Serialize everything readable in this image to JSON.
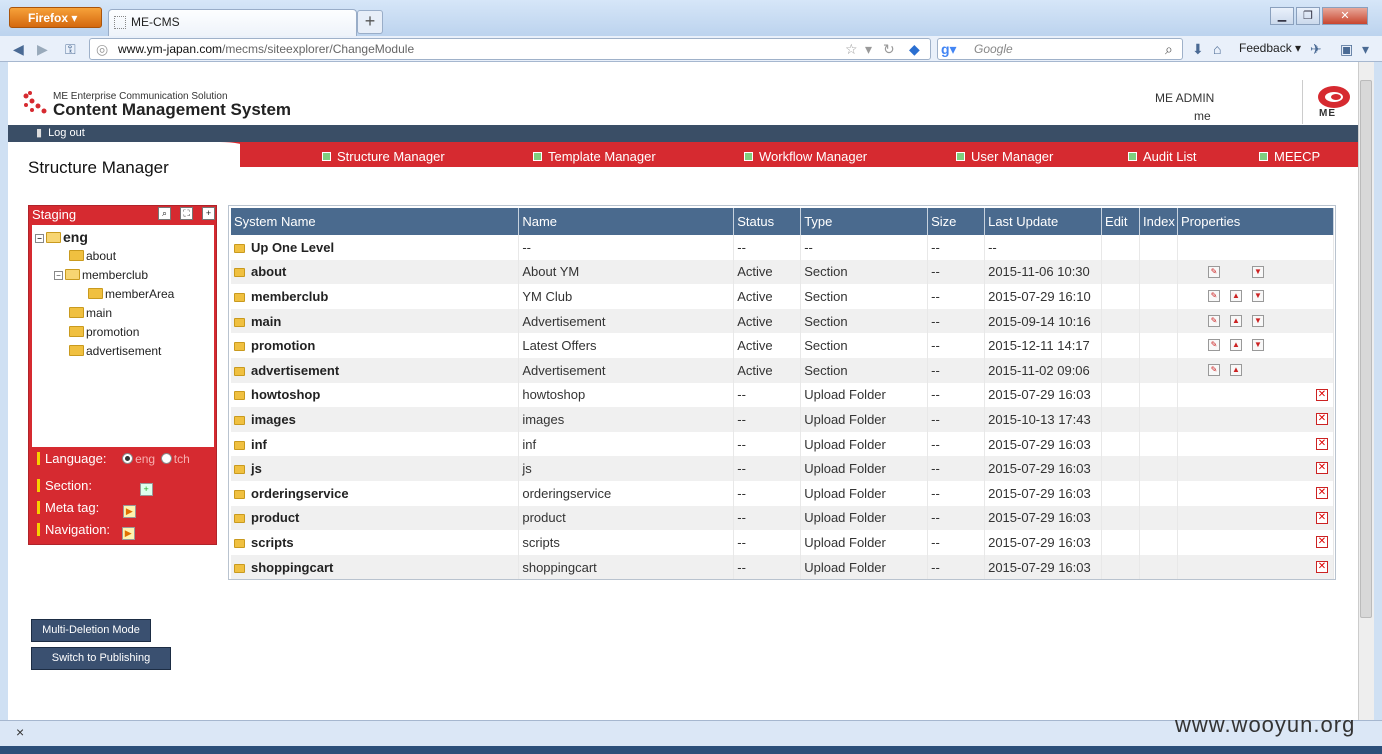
{
  "browser": {
    "menu_button": "Firefox",
    "tab_title": "ME-CMS",
    "new_tab": "+",
    "url_domain": "www.ym-japan.com",
    "url_path": "/mecms/siteexplorer/ChangeModule",
    "search_placeholder": "Google",
    "feedback_label": "Feedback",
    "status_close": "×",
    "watermark": "www.wooyun.org"
  },
  "header": {
    "logo_small": "ME Enterprise Communication Solution",
    "logo_big": "Content Management System",
    "admin_name": "ME ADMIN",
    "admin_user": "me",
    "brand": "ME",
    "logout": "Log out"
  },
  "menu": [
    {
      "label": "Structure Manager"
    },
    {
      "label": "Template Manager"
    },
    {
      "label": "Workflow Manager"
    },
    {
      "label": "User Manager"
    },
    {
      "label": "Audit List"
    },
    {
      "label": "MEECP"
    }
  ],
  "page_title": "Structure Manager",
  "sidebar": {
    "title": "Staging",
    "tree": {
      "root": "eng",
      "n1": "about",
      "n2": "memberclub",
      "n3": "memberArea",
      "n4": "main",
      "n5": "promotion",
      "n6": "advertisement"
    },
    "language_label": "Language:",
    "lang_eng": "eng",
    "lang_tch": "tch",
    "section_label": "Section:",
    "meta_label": "Meta tag:",
    "nav_label": "Navigation:"
  },
  "table": {
    "headers": [
      "System Name",
      "Name",
      "Status",
      "Type",
      "Size",
      "Last Update",
      "Edit",
      "Index",
      "Properties"
    ],
    "rows": [
      {
        "sys": "Up One Level",
        "name": "--",
        "status": "--",
        "type": "--",
        "size": "--",
        "updated": "--",
        "props": ""
      },
      {
        "sys": "about",
        "name": "About YM",
        "status": "Active",
        "type": "Section",
        "size": "--",
        "updated": "2015-11-06 10:30",
        "props": "edit-down"
      },
      {
        "sys": "memberclub",
        "name": "YM Club",
        "status": "Active",
        "type": "Section",
        "size": "--",
        "updated": "2015-07-29 16:10",
        "props": "edit-up-down"
      },
      {
        "sys": "main",
        "name": "Advertisement",
        "status": "Active",
        "type": "Section",
        "size": "--",
        "updated": "2015-09-14 10:16",
        "props": "edit-up-down"
      },
      {
        "sys": "promotion",
        "name": "Latest Offers",
        "status": "Active",
        "type": "Section",
        "size": "--",
        "updated": "2015-12-11 14:17",
        "props": "edit-up-down"
      },
      {
        "sys": "advertisement",
        "name": "Advertisement",
        "status": "Active",
        "type": "Section",
        "size": "--",
        "updated": "2015-11-02 09:06",
        "props": "edit-up"
      },
      {
        "sys": "howtoshop",
        "name": "howtoshop",
        "status": "--",
        "type": "Upload Folder",
        "size": "--",
        "updated": "2015-07-29 16:03",
        "props": "delete"
      },
      {
        "sys": "images",
        "name": "images",
        "status": "--",
        "type": "Upload Folder",
        "size": "--",
        "updated": "2015-10-13 17:43",
        "props": "delete"
      },
      {
        "sys": "inf",
        "name": "inf",
        "status": "--",
        "type": "Upload Folder",
        "size": "--",
        "updated": "2015-07-29 16:03",
        "props": "delete"
      },
      {
        "sys": "js",
        "name": "js",
        "status": "--",
        "type": "Upload Folder",
        "size": "--",
        "updated": "2015-07-29 16:03",
        "props": "delete"
      },
      {
        "sys": "orderingservice",
        "name": "orderingservice",
        "status": "--",
        "type": "Upload Folder",
        "size": "--",
        "updated": "2015-07-29 16:03",
        "props": "delete"
      },
      {
        "sys": "product",
        "name": "product",
        "status": "--",
        "type": "Upload Folder",
        "size": "--",
        "updated": "2015-07-29 16:03",
        "props": "delete"
      },
      {
        "sys": "scripts",
        "name": "scripts",
        "status": "--",
        "type": "Upload Folder",
        "size": "--",
        "updated": "2015-07-29 16:03",
        "props": "delete"
      },
      {
        "sys": "shoppingcart",
        "name": "shoppingcart",
        "status": "--",
        "type": "Upload Folder",
        "size": "--",
        "updated": "2015-07-29 16:03",
        "props": "delete"
      }
    ]
  },
  "buttons": {
    "multi_delete": "Multi-Deletion Mode",
    "publish": "Switch to Publishing Mode"
  }
}
